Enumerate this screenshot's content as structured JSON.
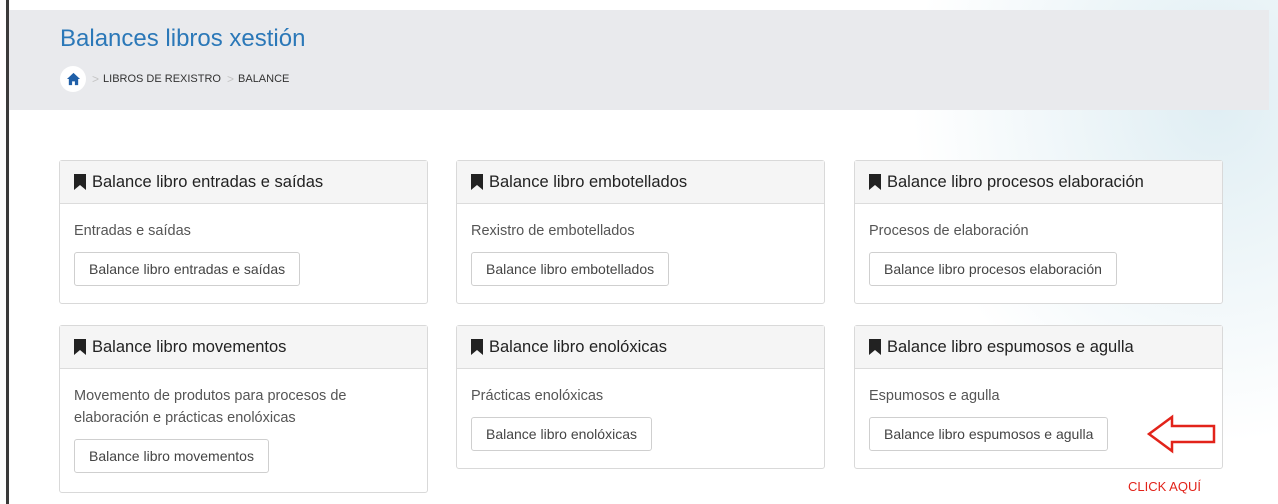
{
  "page": {
    "title": "Balances libros xestión",
    "breadcrumb": [
      "LIBROS DE REXISTRO",
      "BALANCE"
    ]
  },
  "cards": [
    {
      "title": "Balance libro entradas e saídas",
      "description": "Entradas e saídas",
      "button": "Balance libro entradas e saídas"
    },
    {
      "title": "Balance libro embotellados",
      "description": "Rexistro de embotellados",
      "button": "Balance libro embotellados"
    },
    {
      "title": "Balance libro procesos elaboración",
      "description": "Procesos de elaboración",
      "button": "Balance libro procesos elaboración"
    },
    {
      "title": "Balance libro movementos",
      "description": "Movemento de produtos para procesos de elaboración e prácticas enolóxicas",
      "button": "Balance libro movementos"
    },
    {
      "title": "Balance libro enolóxicas",
      "description": "Prácticas enolóxicas",
      "button": "Balance libro enolóxicas"
    },
    {
      "title": "Balance libro espumosos e agulla",
      "description": "Espumosos e agulla",
      "button": "Balance libro espumosos e agulla"
    }
  ],
  "annotation": {
    "label": "CLICK AQUÍ",
    "color": "#e2231a"
  },
  "colors": {
    "title": "#2b78b8",
    "header_bg": "#e9eaed",
    "home_icon": "#1f5fa8"
  },
  "icons": {
    "home": "home-icon",
    "card_header": "bookmark-icon",
    "annotation": "arrow-left-icon"
  }
}
